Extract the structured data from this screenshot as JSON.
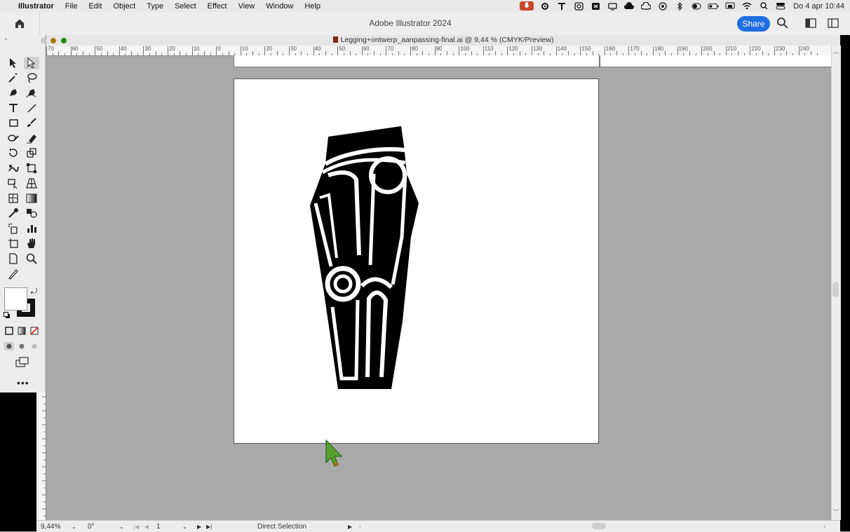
{
  "menubar": {
    "apple_glyph": "",
    "app_name": "Illustrator",
    "items": [
      "File",
      "Edit",
      "Object",
      "Type",
      "Select",
      "Effect",
      "View",
      "Window",
      "Help"
    ],
    "clock": "Do 4 apr  10:44"
  },
  "appbar": {
    "title": "Adobe Illustrator 2024",
    "share_label": "Share"
  },
  "document": {
    "title": "Legging+ontwerp_aanpassing-final.ai @ 9,44 % (CMYK/Preview)"
  },
  "ruler": {
    "labels": [
      "70",
      "60",
      "50",
      "40",
      "30",
      "20",
      "10",
      "0",
      "10",
      "20",
      "30",
      "40",
      "50",
      "60",
      "70",
      "80",
      "90",
      "100",
      "110",
      "120",
      "130",
      "140",
      "150",
      "160",
      "170",
      "180",
      "190",
      "200",
      "210",
      "220",
      "230",
      "240"
    ]
  },
  "statusbar": {
    "zoom": "9,44%",
    "rotation": "0°",
    "artboard_number": "1",
    "tool_name": "Direct Selection"
  },
  "colors": {
    "accent": "#1f6fe0",
    "canvas_bg": "#a9a9a9",
    "artwork": "#000000",
    "cursor": "#5aa02c"
  },
  "toolbar": {
    "tools": [
      "selection-tool",
      "direct-selection-tool",
      "magic-wand-tool",
      "lasso-tool",
      "pen-tool",
      "curvature-tool",
      "type-tool",
      "line-tool",
      "rectangle-tool",
      "paintbrush-tool",
      "shaper-tool",
      "eraser-tool",
      "rotate-tool",
      "scale-tool",
      "warp-tool",
      "free-transform-tool",
      "shape-builder-tool",
      "perspective-grid-tool",
      "mesh-tool",
      "gradient-tool",
      "eyedropper-tool",
      "blend-tool",
      "symbol-sprayer-tool",
      "graph-tool",
      "artboard-tool",
      "hand-tool",
      "slice-tool",
      "zoom-tool",
      "knife-tool"
    ]
  }
}
